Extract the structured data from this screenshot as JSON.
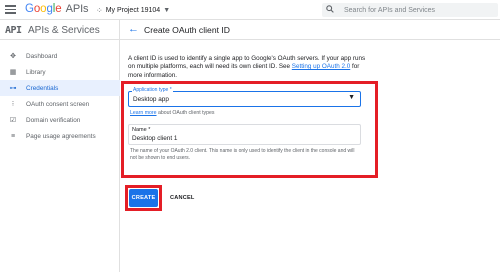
{
  "topbar": {
    "menu_icon": "hamburger-menu-icon",
    "logo_google": [
      "G",
      "o",
      "o",
      "g",
      "l",
      "e"
    ],
    "logo_apis": "APIs",
    "project_icon": "project-dots-icon",
    "project_name": "My Project 19104",
    "project_caret": "▼",
    "search_icon": "search-icon",
    "search_placeholder": "Search for APIs and Services"
  },
  "sidebar": {
    "logo": "API",
    "title": "APIs & Services",
    "items": [
      {
        "label": "Dashboard",
        "icon": "dashboard-icon",
        "glyph": "✥",
        "active": false
      },
      {
        "label": "Library",
        "icon": "library-icon",
        "glyph": "▦",
        "active": false
      },
      {
        "label": "Credentials",
        "icon": "key-icon",
        "glyph": "⊶",
        "active": true
      },
      {
        "label": "OAuth consent screen",
        "icon": "consent-icon",
        "glyph": "⁝",
        "active": false
      },
      {
        "label": "Domain verification",
        "icon": "domain-verification-icon",
        "glyph": "☑",
        "active": false
      },
      {
        "label": "Page usage agreements",
        "icon": "settings-icon",
        "glyph": "≡",
        "active": false
      }
    ]
  },
  "main": {
    "back_icon": "back-arrow-icon",
    "back_glyph": "←",
    "title": "Create OAuth client ID",
    "description_before": "A client ID is used to identify a single app to Google's OAuth servers. If your app runs on multiple platforms, each will need its own client ID. See ",
    "description_link": "Setting up OAuth 2.0",
    "description_after": " for more information.",
    "app_type_label": "Application type *",
    "app_type_value": "Desktop app",
    "app_type_arrow": "▼",
    "learn_link": "Learn more",
    "learn_rest": " about OAuth client types",
    "name_label": "Name *",
    "name_value": "Desktop client 1",
    "name_hint": "The name of your OAuth 2.0 client. This name is only used to identify the client in the console and will not be shown to end users.",
    "create_label": "CREATE",
    "cancel_label": "CANCEL"
  },
  "colors": {
    "accent": "#1a73e8",
    "highlight": "#e41e26",
    "active_bg": "#e8f0fe"
  }
}
